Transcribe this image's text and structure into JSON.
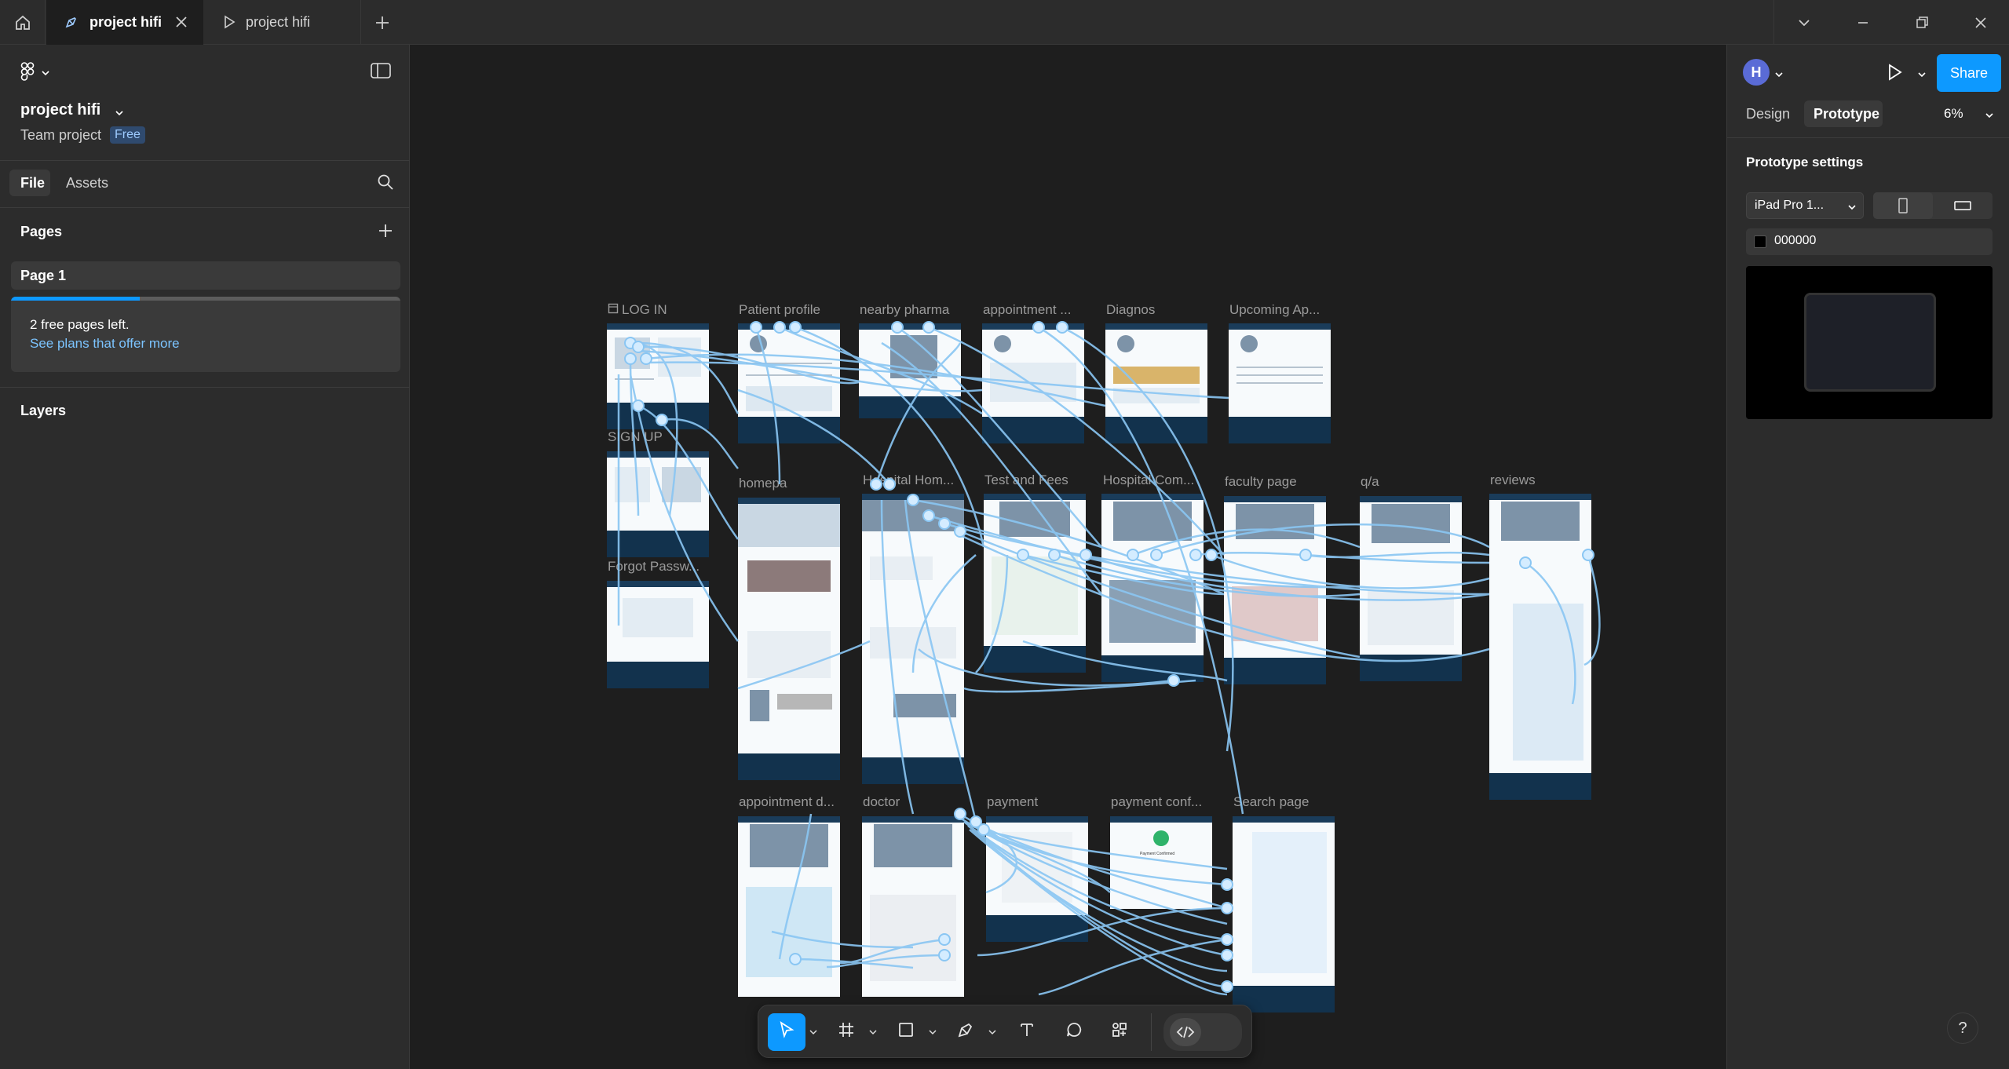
{
  "tabs": [
    {
      "label": "project hifi",
      "type": "design",
      "active": true
    },
    {
      "label": "project hifi",
      "type": "prototype",
      "active": false
    }
  ],
  "file": {
    "name": "project hifi",
    "team": "Team project",
    "plan_badge": "Free"
  },
  "left_tabs": {
    "file": "File",
    "assets": "Assets"
  },
  "pages": {
    "heading": "Pages",
    "items": [
      "Page 1"
    ],
    "notice": "2 free pages left.",
    "notice_link": "See plans that offer more",
    "used_fraction": 0.33
  },
  "layers": {
    "heading": "Layers"
  },
  "right": {
    "avatar_initial": "H",
    "share_label": "Share",
    "tabs": {
      "design": "Design",
      "prototype": "Prototype"
    },
    "zoom": "6%",
    "section_title": "Prototype settings",
    "device": "iPad Pro 1...",
    "background_hex": "000000",
    "colors": {
      "accent": "#0d99ff",
      "avatar": "#5a6bd6",
      "preview_bg": "#000000"
    }
  },
  "frames": [
    {
      "label": "LOG IN",
      "frame_icon": true
    },
    {
      "label": "SIGN UP"
    },
    {
      "label": "Forgot Passw..."
    },
    {
      "label": "Patient profile"
    },
    {
      "label": "nearby pharma"
    },
    {
      "label": "appointment ..."
    },
    {
      "label": "Diagnos"
    },
    {
      "label": "Upcoming Ap..."
    },
    {
      "label": "homepa"
    },
    {
      "label": "Hospital Hom..."
    },
    {
      "label": "Test and Fees"
    },
    {
      "label": "Hospital Com..."
    },
    {
      "label": "faculty page"
    },
    {
      "label": "q/a"
    },
    {
      "label": "reviews"
    },
    {
      "label": "appointment d..."
    },
    {
      "label": "doctor"
    },
    {
      "label": "payment"
    },
    {
      "label": "payment conf..."
    },
    {
      "label": "Search page"
    }
  ],
  "frame_inner": {
    "confirm_text": "Payment Confirmed"
  },
  "toolbar": {
    "tools": [
      "move-tool",
      "frame-tool",
      "shape-tool",
      "pen-tool",
      "text-tool",
      "comment-tool",
      "resources-tool",
      "dev-mode-toggle"
    ]
  },
  "help_label": "?"
}
